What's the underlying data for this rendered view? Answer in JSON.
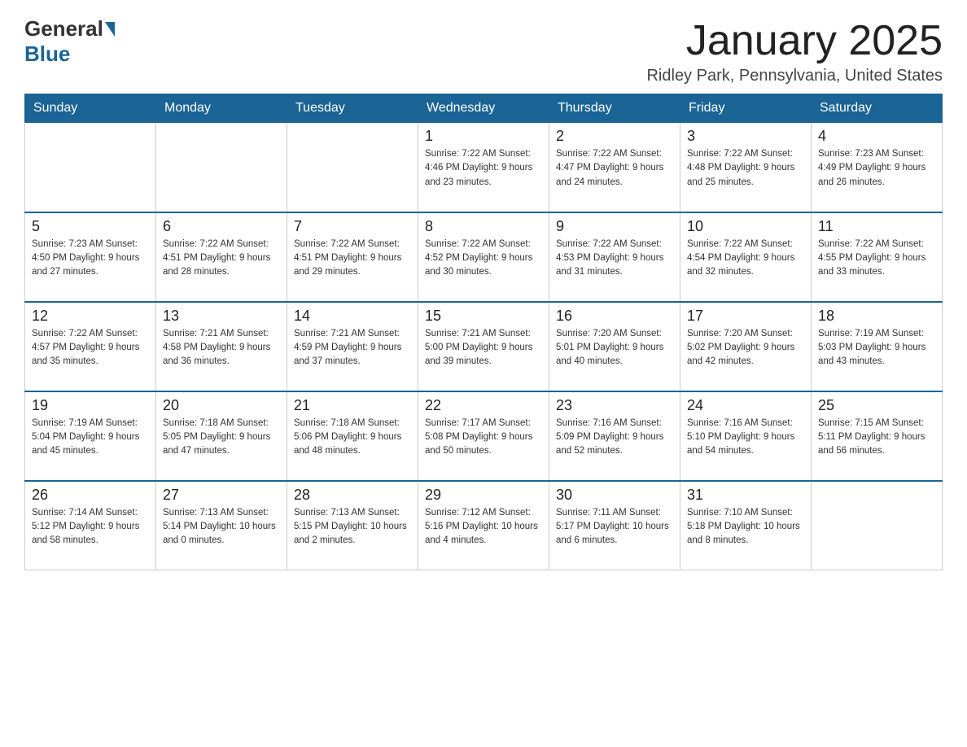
{
  "header": {
    "logo_general": "General",
    "logo_blue": "Blue",
    "month_title": "January 2025",
    "location": "Ridley Park, Pennsylvania, United States"
  },
  "days_of_week": [
    "Sunday",
    "Monday",
    "Tuesday",
    "Wednesday",
    "Thursday",
    "Friday",
    "Saturday"
  ],
  "weeks": [
    [
      {
        "day": "",
        "info": ""
      },
      {
        "day": "",
        "info": ""
      },
      {
        "day": "",
        "info": ""
      },
      {
        "day": "1",
        "info": "Sunrise: 7:22 AM\nSunset: 4:46 PM\nDaylight: 9 hours\nand 23 minutes."
      },
      {
        "day": "2",
        "info": "Sunrise: 7:22 AM\nSunset: 4:47 PM\nDaylight: 9 hours\nand 24 minutes."
      },
      {
        "day": "3",
        "info": "Sunrise: 7:22 AM\nSunset: 4:48 PM\nDaylight: 9 hours\nand 25 minutes."
      },
      {
        "day": "4",
        "info": "Sunrise: 7:23 AM\nSunset: 4:49 PM\nDaylight: 9 hours\nand 26 minutes."
      }
    ],
    [
      {
        "day": "5",
        "info": "Sunrise: 7:23 AM\nSunset: 4:50 PM\nDaylight: 9 hours\nand 27 minutes."
      },
      {
        "day": "6",
        "info": "Sunrise: 7:22 AM\nSunset: 4:51 PM\nDaylight: 9 hours\nand 28 minutes."
      },
      {
        "day": "7",
        "info": "Sunrise: 7:22 AM\nSunset: 4:51 PM\nDaylight: 9 hours\nand 29 minutes."
      },
      {
        "day": "8",
        "info": "Sunrise: 7:22 AM\nSunset: 4:52 PM\nDaylight: 9 hours\nand 30 minutes."
      },
      {
        "day": "9",
        "info": "Sunrise: 7:22 AM\nSunset: 4:53 PM\nDaylight: 9 hours\nand 31 minutes."
      },
      {
        "day": "10",
        "info": "Sunrise: 7:22 AM\nSunset: 4:54 PM\nDaylight: 9 hours\nand 32 minutes."
      },
      {
        "day": "11",
        "info": "Sunrise: 7:22 AM\nSunset: 4:55 PM\nDaylight: 9 hours\nand 33 minutes."
      }
    ],
    [
      {
        "day": "12",
        "info": "Sunrise: 7:22 AM\nSunset: 4:57 PM\nDaylight: 9 hours\nand 35 minutes."
      },
      {
        "day": "13",
        "info": "Sunrise: 7:21 AM\nSunset: 4:58 PM\nDaylight: 9 hours\nand 36 minutes."
      },
      {
        "day": "14",
        "info": "Sunrise: 7:21 AM\nSunset: 4:59 PM\nDaylight: 9 hours\nand 37 minutes."
      },
      {
        "day": "15",
        "info": "Sunrise: 7:21 AM\nSunset: 5:00 PM\nDaylight: 9 hours\nand 39 minutes."
      },
      {
        "day": "16",
        "info": "Sunrise: 7:20 AM\nSunset: 5:01 PM\nDaylight: 9 hours\nand 40 minutes."
      },
      {
        "day": "17",
        "info": "Sunrise: 7:20 AM\nSunset: 5:02 PM\nDaylight: 9 hours\nand 42 minutes."
      },
      {
        "day": "18",
        "info": "Sunrise: 7:19 AM\nSunset: 5:03 PM\nDaylight: 9 hours\nand 43 minutes."
      }
    ],
    [
      {
        "day": "19",
        "info": "Sunrise: 7:19 AM\nSunset: 5:04 PM\nDaylight: 9 hours\nand 45 minutes."
      },
      {
        "day": "20",
        "info": "Sunrise: 7:18 AM\nSunset: 5:05 PM\nDaylight: 9 hours\nand 47 minutes."
      },
      {
        "day": "21",
        "info": "Sunrise: 7:18 AM\nSunset: 5:06 PM\nDaylight: 9 hours\nand 48 minutes."
      },
      {
        "day": "22",
        "info": "Sunrise: 7:17 AM\nSunset: 5:08 PM\nDaylight: 9 hours\nand 50 minutes."
      },
      {
        "day": "23",
        "info": "Sunrise: 7:16 AM\nSunset: 5:09 PM\nDaylight: 9 hours\nand 52 minutes."
      },
      {
        "day": "24",
        "info": "Sunrise: 7:16 AM\nSunset: 5:10 PM\nDaylight: 9 hours\nand 54 minutes."
      },
      {
        "day": "25",
        "info": "Sunrise: 7:15 AM\nSunset: 5:11 PM\nDaylight: 9 hours\nand 56 minutes."
      }
    ],
    [
      {
        "day": "26",
        "info": "Sunrise: 7:14 AM\nSunset: 5:12 PM\nDaylight: 9 hours\nand 58 minutes."
      },
      {
        "day": "27",
        "info": "Sunrise: 7:13 AM\nSunset: 5:14 PM\nDaylight: 10 hours\nand 0 minutes."
      },
      {
        "day": "28",
        "info": "Sunrise: 7:13 AM\nSunset: 5:15 PM\nDaylight: 10 hours\nand 2 minutes."
      },
      {
        "day": "29",
        "info": "Sunrise: 7:12 AM\nSunset: 5:16 PM\nDaylight: 10 hours\nand 4 minutes."
      },
      {
        "day": "30",
        "info": "Sunrise: 7:11 AM\nSunset: 5:17 PM\nDaylight: 10 hours\nand 6 minutes."
      },
      {
        "day": "31",
        "info": "Sunrise: 7:10 AM\nSunset: 5:18 PM\nDaylight: 10 hours\nand 8 minutes."
      },
      {
        "day": "",
        "info": ""
      }
    ]
  ]
}
